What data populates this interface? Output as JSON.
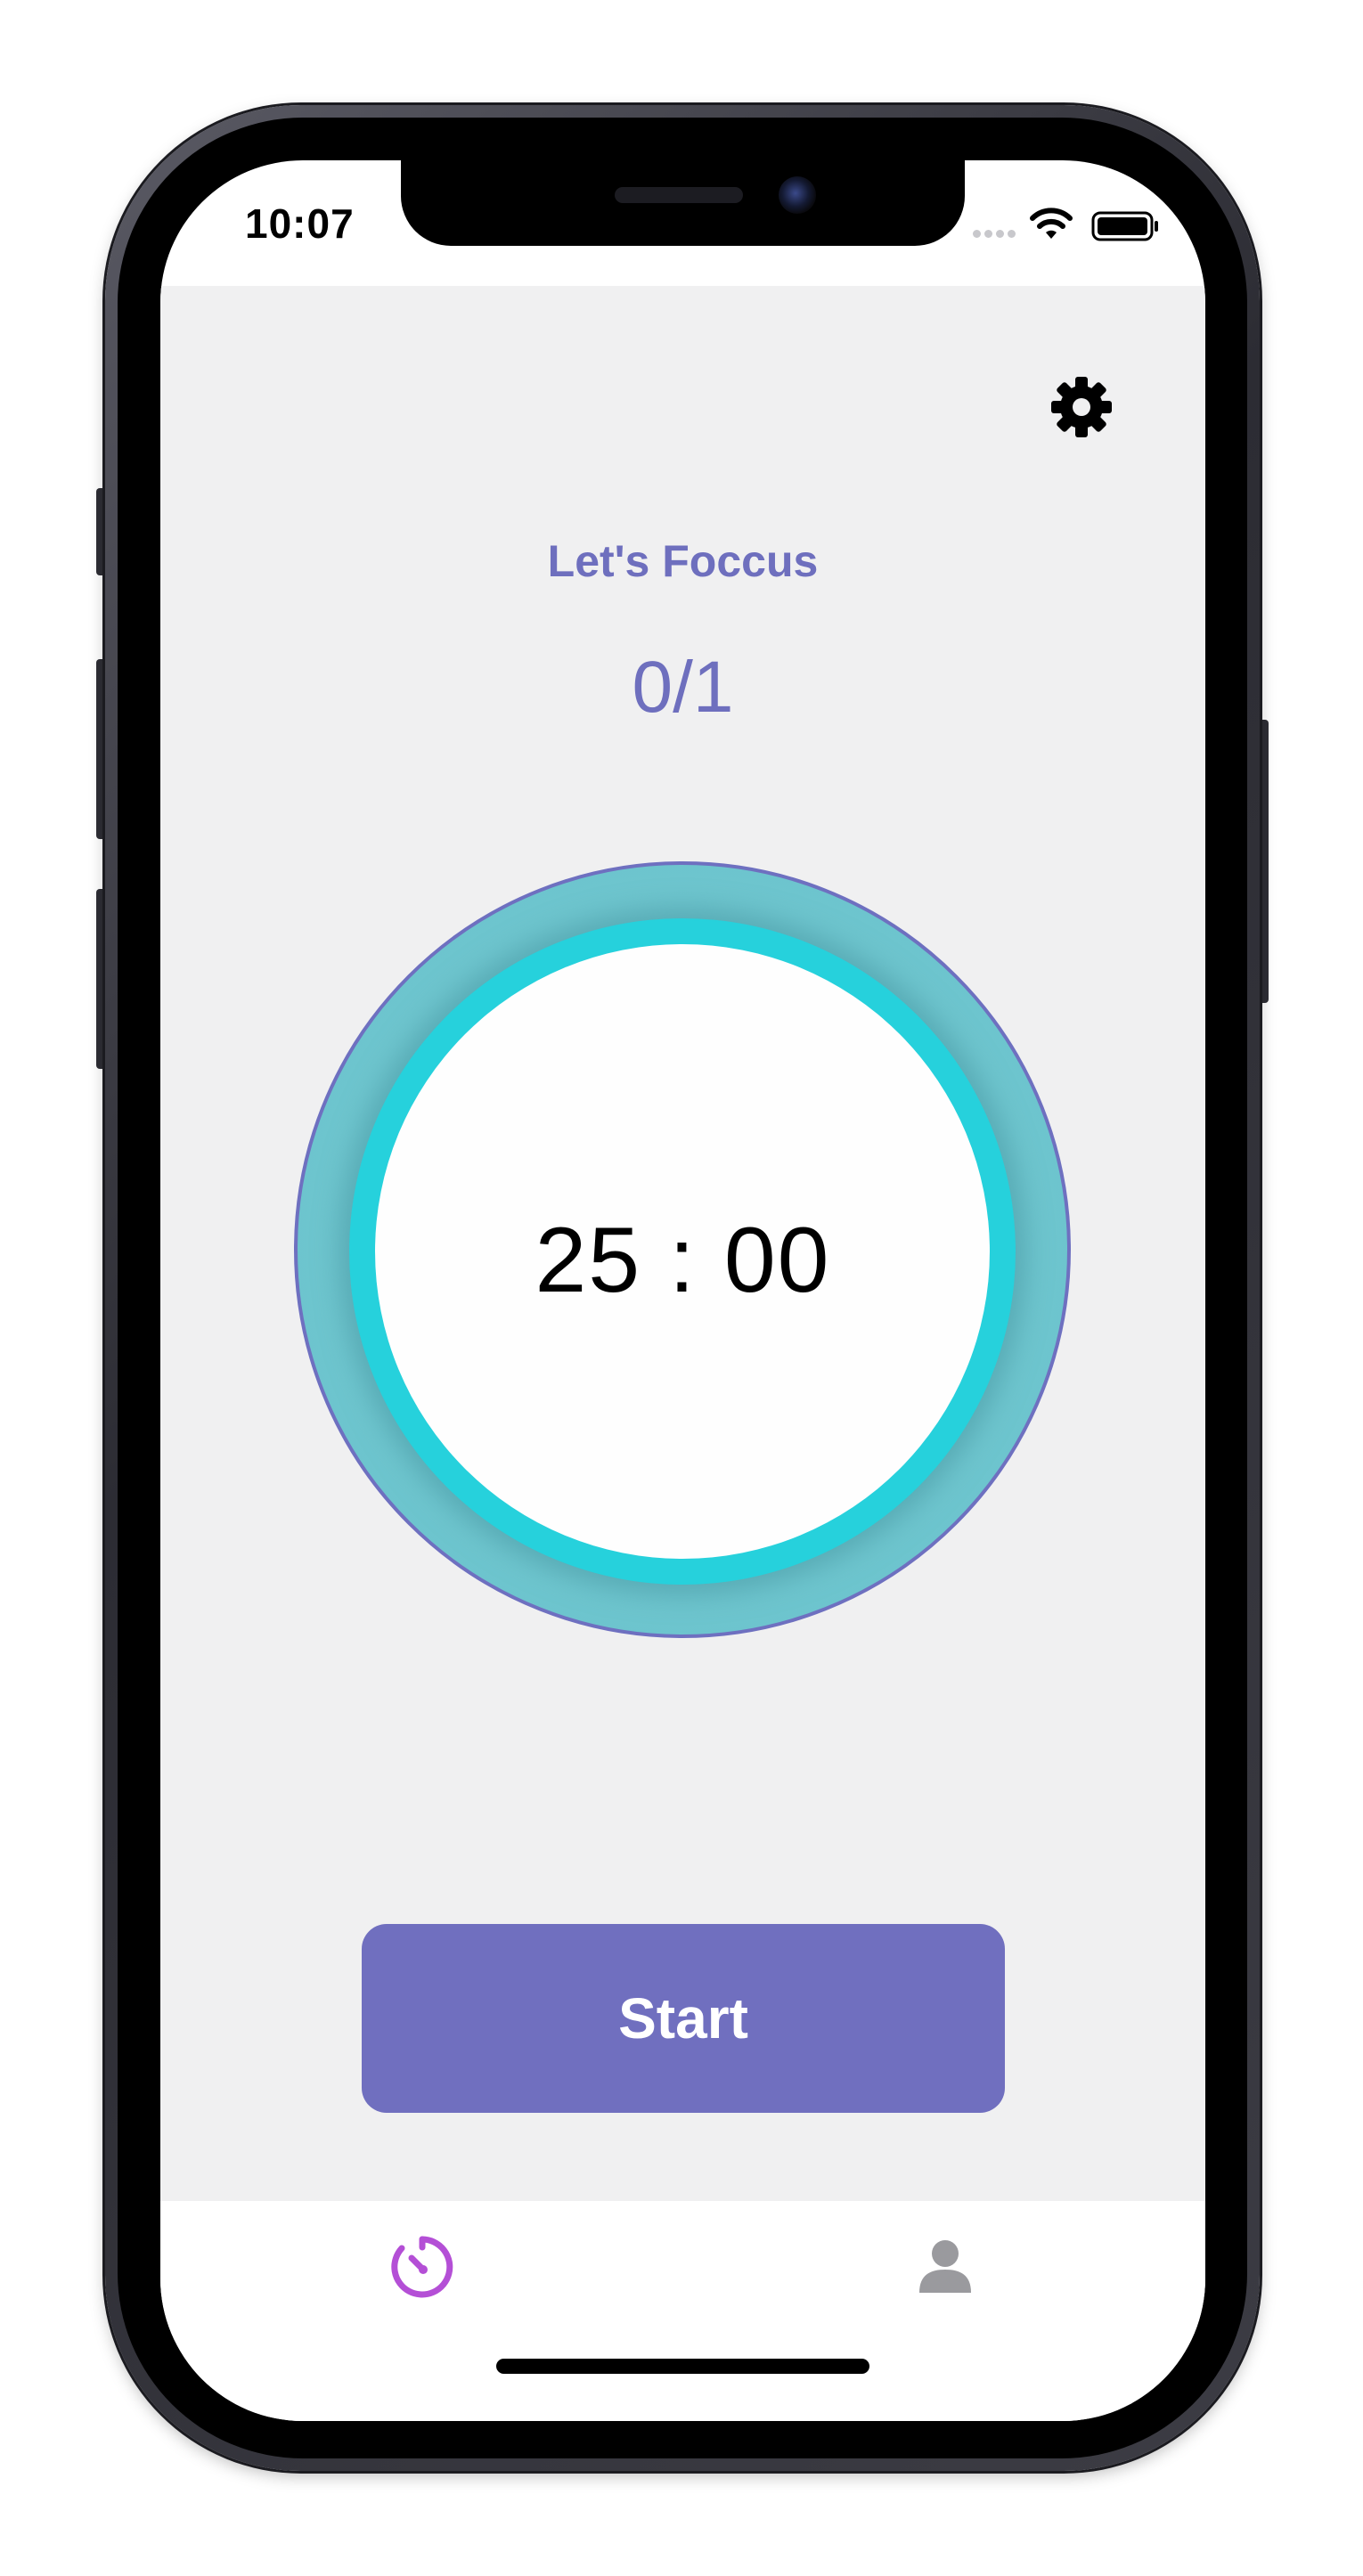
{
  "status_bar": {
    "time": "10:07"
  },
  "header": {
    "settings_icon": "gear-icon"
  },
  "main": {
    "title": "Let's Foccus",
    "counter": "0/1",
    "timer": "25 : 00",
    "start_label": "Start"
  },
  "tabs": [
    {
      "icon": "timer-icon",
      "active": true
    },
    {
      "icon": "person-icon",
      "active": false
    }
  ],
  "colors": {
    "accent": "#706fbf",
    "ring": "#26d1dc",
    "active_tab": "#b44fd6",
    "inactive_tab": "#9a9a9e",
    "background": "#f0f0f1"
  }
}
